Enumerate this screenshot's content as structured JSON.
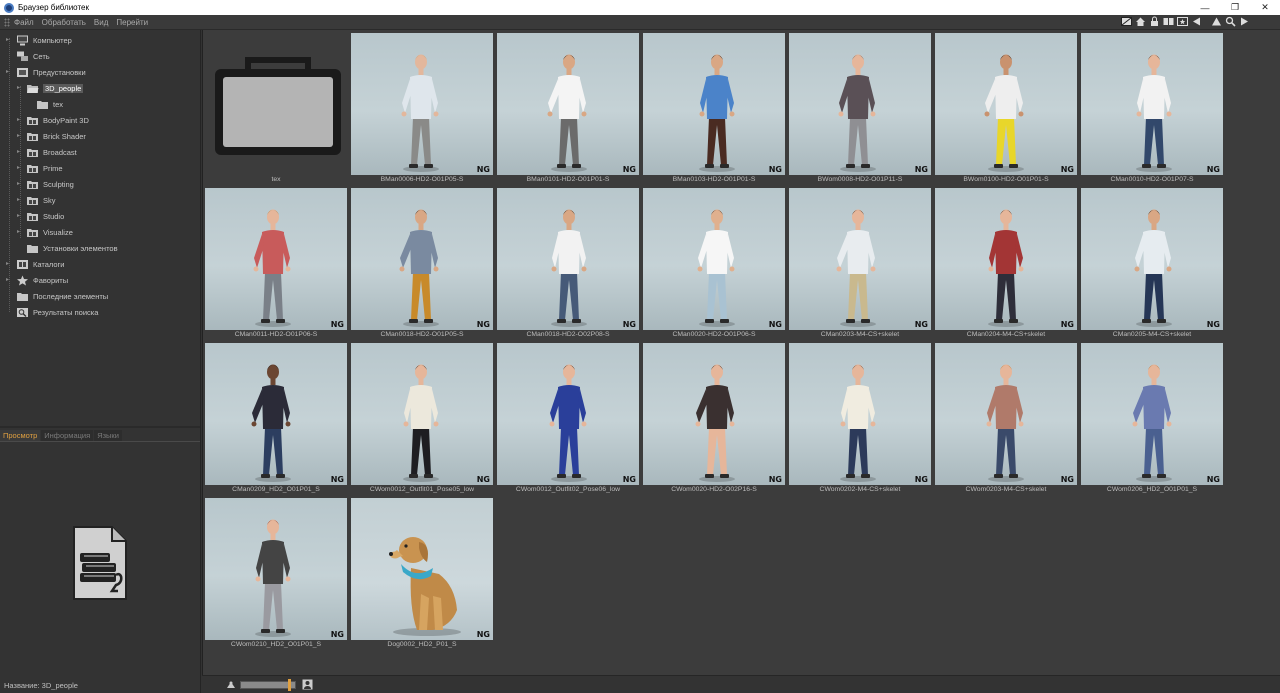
{
  "window": {
    "title": "Браузер библиотек",
    "minimize": "—",
    "restore": "❐",
    "close": "✕"
  },
  "menu": [
    "Файл",
    "Обработать",
    "Вид",
    "Перейти"
  ],
  "tree": [
    {
      "label": "Компьютер",
      "icon": "computer-icon"
    },
    {
      "label": "Сеть",
      "icon": "network-icon"
    },
    {
      "label": "Предустановки",
      "icon": "presets-icon"
    },
    {
      "label": "3D_people",
      "icon": "folder-open-icon",
      "selected": true
    },
    {
      "label": "tex",
      "icon": "folder-icon"
    },
    {
      "label": "BodyPaint 3D",
      "icon": "library-icon"
    },
    {
      "label": "Brick Shader",
      "icon": "library-icon"
    },
    {
      "label": "Broadcast",
      "icon": "library-icon"
    },
    {
      "label": "Prime",
      "icon": "library-icon"
    },
    {
      "label": "Sculpting",
      "icon": "library-icon"
    },
    {
      "label": "Sky",
      "icon": "library-icon"
    },
    {
      "label": "Studio",
      "icon": "library-icon"
    },
    {
      "label": "Visualize",
      "icon": "library-icon"
    },
    {
      "label": "Установки элементов",
      "icon": "folder-icon"
    },
    {
      "label": "Каталоги",
      "icon": "catalogs-icon"
    },
    {
      "label": "Фавориты",
      "icon": "star-icon"
    },
    {
      "label": "Последние элементы",
      "icon": "folder-icon"
    },
    {
      "label": "Результаты поиска",
      "icon": "search-results-icon"
    }
  ],
  "tabs": [
    "Просмотр",
    "Информация",
    "Языки"
  ],
  "info": {
    "name_line": "Название: 3D_people"
  },
  "badge": "NG",
  "items": [
    {
      "caption": "tex",
      "kind": "folder"
    },
    {
      "caption": "BMan0006-HD2-O01P05-S",
      "kind": "person",
      "shirt": "#dfe6ec",
      "pants": "#8a8a88",
      "skin": "#e3b79c",
      "hair": "#c9a67f"
    },
    {
      "caption": "BMan0101-HD2-O01P01-S",
      "kind": "person",
      "shirt": "#f4f4f4",
      "pants": "#6b6b6b",
      "skin": "#d9a784",
      "hair": "#1a1a1a"
    },
    {
      "caption": "BMan0103-HD2-O01P01-S",
      "kind": "person",
      "shirt": "#4b83c9",
      "pants": "#4a2b22",
      "skin": "#d9a784",
      "hair": "#1a1a1a"
    },
    {
      "caption": "BWom0008-HD2-O01P11-S",
      "kind": "person",
      "shirt": "#5a5056",
      "pants": "#8f8f93",
      "skin": "#e6b69a",
      "hair": "#6b6b6b"
    },
    {
      "caption": "BWom0100-HD2-O01P01-S",
      "kind": "person",
      "shirt": "#eeeeee",
      "pants": "#e8d62a",
      "skin": "#c9926e",
      "hair": "#1a1a1a"
    },
    {
      "caption": "CMan0010-HD2-O01P07-S",
      "kind": "person",
      "shirt": "#f2f2f2",
      "pants": "#32486b",
      "skin": "#e6b69a",
      "hair": "#3a2a20"
    },
    {
      "caption": "CMan0011-HD2-O01P06-S",
      "kind": "person",
      "shirt": "#c85b5b",
      "pants": "#7a8088",
      "skin": "#e6b69a",
      "hair": "#b08a58"
    },
    {
      "caption": "CMan0018-HD2-O01P05-S",
      "kind": "person",
      "shirt": "#7a8aa0",
      "pants": "#c88a2a",
      "skin": "#d9a784",
      "hair": "#2a1e16"
    },
    {
      "caption": "CMan0018-HD2-O02P08-S",
      "kind": "person",
      "shirt": "#f2f2f2",
      "pants": "#465a78",
      "skin": "#d9a784",
      "hair": "#2a1e16"
    },
    {
      "caption": "CMan0020-HD2-O01P06-S",
      "kind": "person",
      "shirt": "#f6f6f6",
      "pants": "#a9c2d2",
      "skin": "#e0b08e",
      "hair": "#3a2a20"
    },
    {
      "caption": "CMan0203-M4-CS+skelet",
      "kind": "person",
      "shirt": "#e8ecef",
      "pants": "#c9b98e",
      "skin": "#e6b69a",
      "hair": "#3a2a20"
    },
    {
      "caption": "CMan0204-M4-CS+skelet",
      "kind": "person",
      "shirt": "#a33535",
      "pants": "#2e2e3a",
      "skin": "#e6b69a",
      "hair": "#3a2a20"
    },
    {
      "caption": "CMan0205-M4-CS+skelet",
      "kind": "person",
      "shirt": "#e6ecf0",
      "pants": "#253656",
      "skin": "#d9a784",
      "hair": "#1a1a1a"
    },
    {
      "caption": "CMan0209_HD2_O01P01_S",
      "kind": "person",
      "shirt": "#2b2b38",
      "pants": "#2c3e60",
      "skin": "#6b4632",
      "hair": "#1a1a1a"
    },
    {
      "caption": "CWom0012_Outfit01_Pose05_low",
      "kind": "person",
      "shirt": "#ece8dc",
      "pants": "#1e1e22",
      "skin": "#e6b69a",
      "hair": "#2a1e16"
    },
    {
      "caption": "CWom0012_Outfit02_Pose06_low",
      "kind": "person",
      "shirt": "#2a3f9a",
      "pants": "#2a3f9a",
      "skin": "#e6b69a",
      "hair": "#2a1e16"
    },
    {
      "caption": "CWom0020-HD2-O02P16-S",
      "kind": "person",
      "shirt": "#3a3030",
      "pants": "#e6b69a",
      "skin": "#e6b69a",
      "hair": "#2a1e16"
    },
    {
      "caption": "CWom0202-M4-CS+skelet",
      "kind": "person",
      "shirt": "#f0ece0",
      "pants": "#2c3a5a",
      "skin": "#e6b69a",
      "hair": "#5a4030"
    },
    {
      "caption": "CWom0203-M4-CS+skelet",
      "kind": "person",
      "shirt": "#b07a6a",
      "pants": "#3a4a6a",
      "skin": "#e6b69a",
      "hair": "#c08040"
    },
    {
      "caption": "CWom0206_HD2_O01P01_S",
      "kind": "person",
      "shirt": "#6a7ab0",
      "pants": "#4a6090",
      "skin": "#e6b69a",
      "hair": "#b07840"
    },
    {
      "caption": "CWom0210_HD2_O01P01_S",
      "kind": "person",
      "shirt": "#444444",
      "pants": "#9a9aa0",
      "skin": "#e6b69a",
      "hair": "#8a3a2a"
    },
    {
      "caption": "Dog0002_HD2_P01_S",
      "kind": "dog"
    }
  ]
}
